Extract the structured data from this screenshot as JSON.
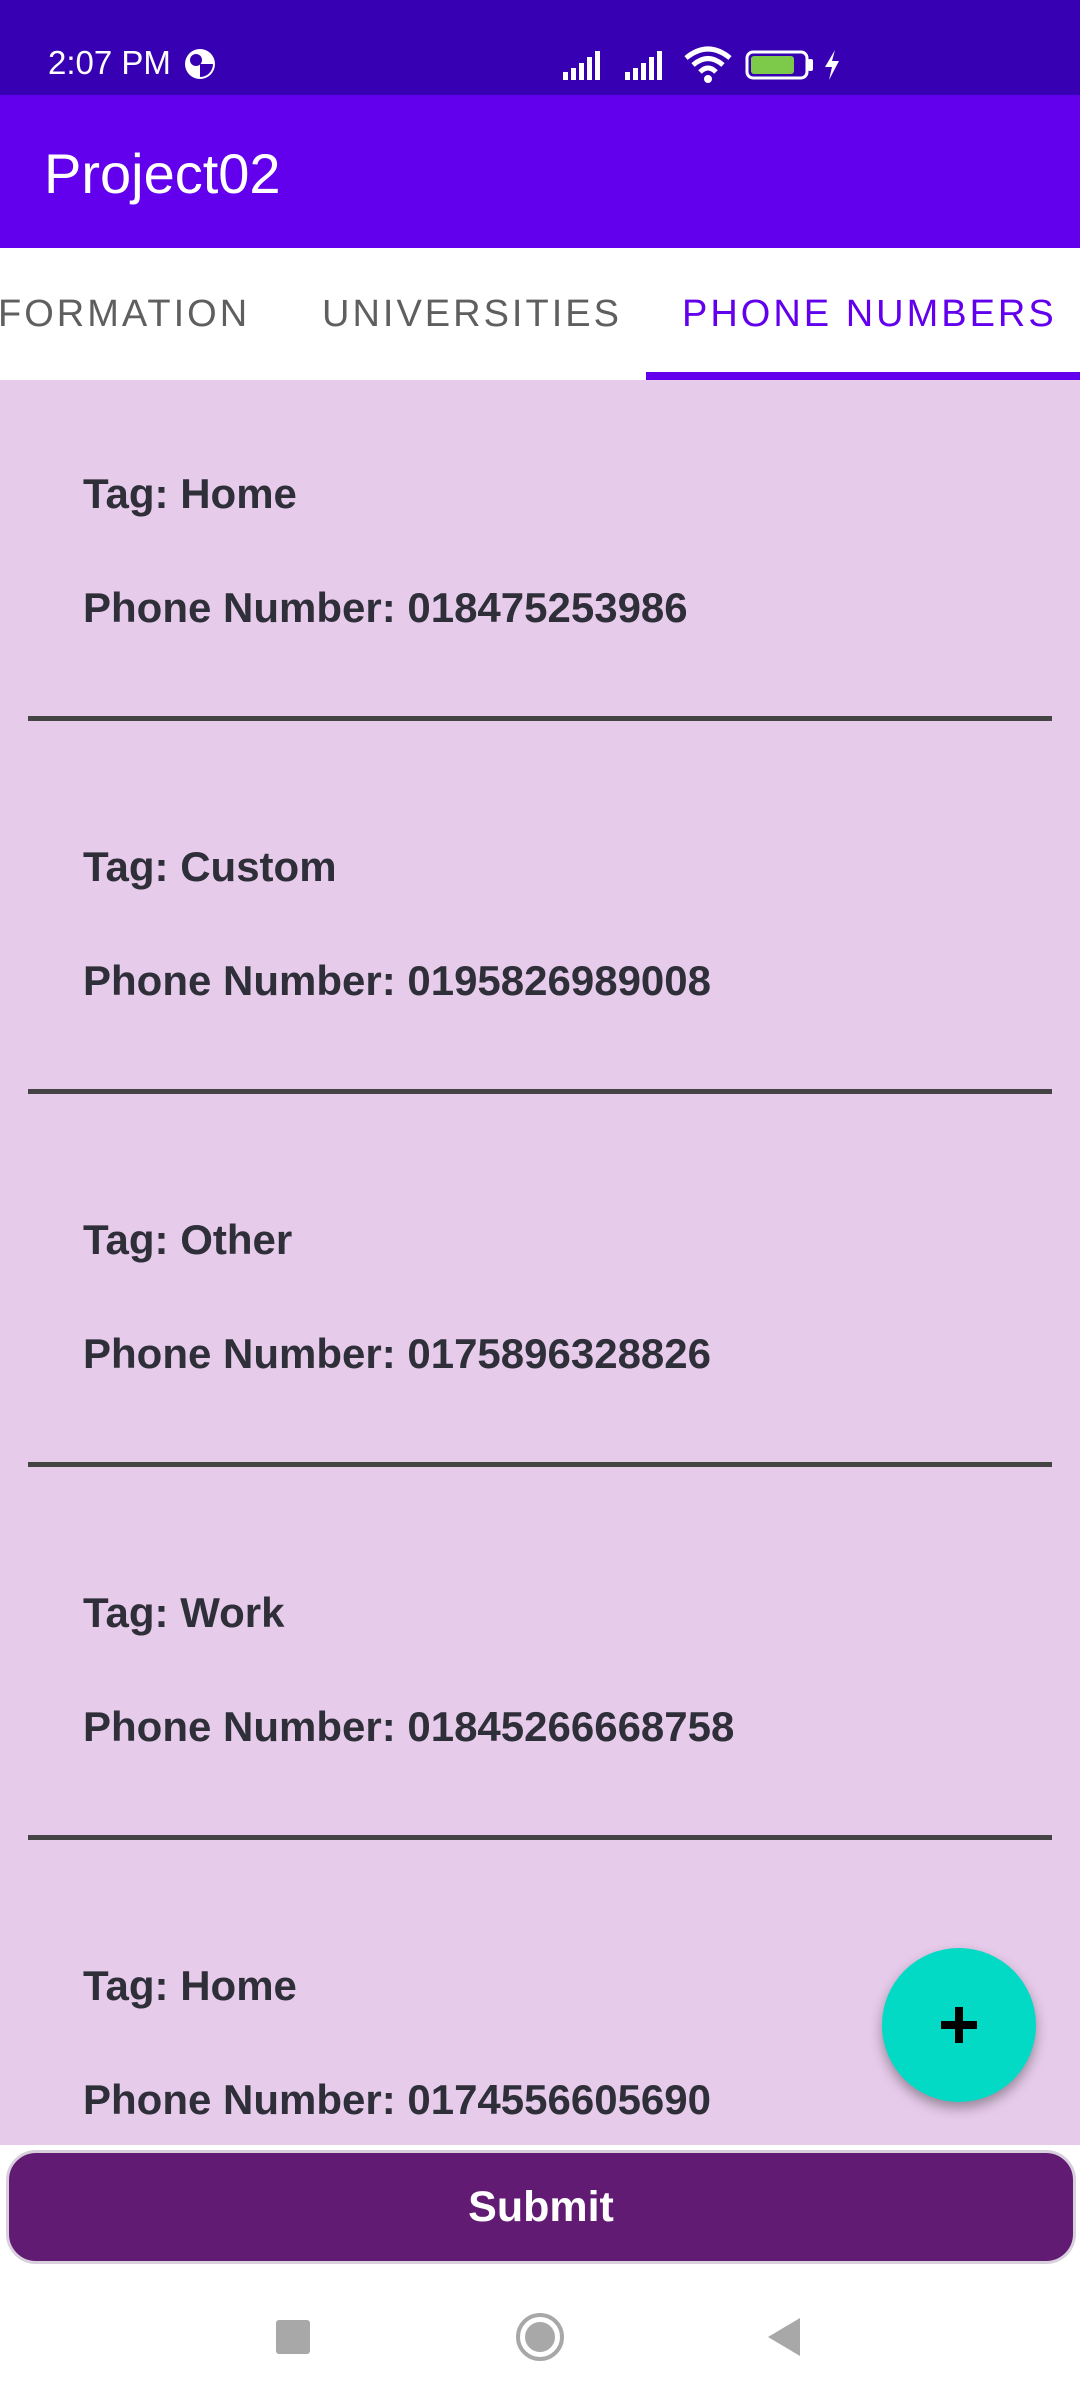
{
  "status_bar": {
    "time": "2:07 PM",
    "battery_level": "82",
    "signal_icons": [
      "signal-icon",
      "signal-icon"
    ],
    "wifi_icon": "wifi-icon",
    "charging_icon": "charging-icon"
  },
  "app_bar": {
    "title": "Project02"
  },
  "tabs": [
    {
      "label": "FORMATION",
      "selected": false
    },
    {
      "label": "UNIVERSITIES",
      "selected": false
    },
    {
      "label": "PHONE NUMBERS",
      "selected": true
    }
  ],
  "phone_entries": [
    {
      "tag": "Tag: Home",
      "phone": "Phone Number: 018475253986"
    },
    {
      "tag": "Tag: Custom",
      "phone": "Phone Number: 0195826989008"
    },
    {
      "tag": "Tag: Other",
      "phone": "Phone Number: 0175896328826"
    },
    {
      "tag": "Tag: Work",
      "phone": "Phone Number: 01845266668758"
    },
    {
      "tag": "Tag: Home",
      "phone": "Phone Number: 0174556605690"
    }
  ],
  "fab": {
    "icon": "plus-icon"
  },
  "submit": {
    "label": "Submit"
  },
  "nav": {
    "recent_icon": "square-icon",
    "home_icon": "circle-icon",
    "back_icon": "triangle-back-icon"
  },
  "colors": {
    "status_bar": "#3700b3",
    "app_bar": "#6200ee",
    "tab_selected": "#6200ee",
    "content_bg": "#e6cbea",
    "fab": "#03dac5",
    "submit": "#621b72"
  }
}
